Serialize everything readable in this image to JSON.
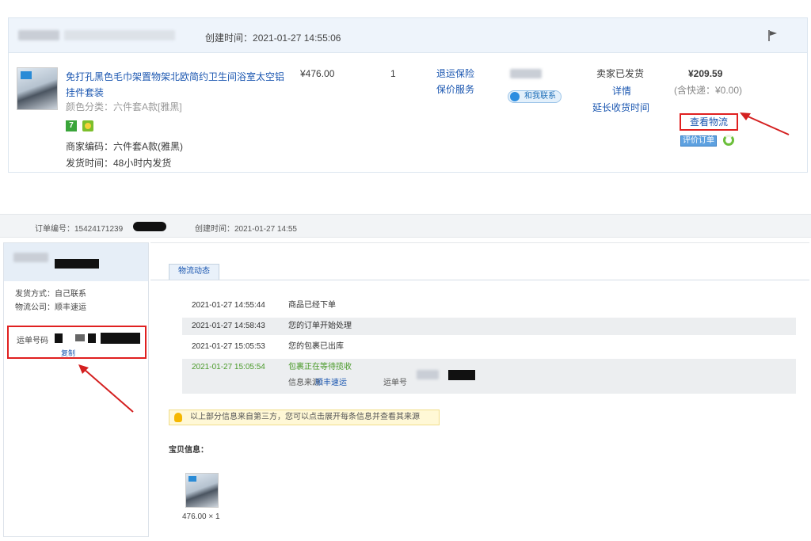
{
  "colors": {
    "header_bg": "#eef4fb",
    "link": "#1a56b0",
    "highlight_red": "#e02020",
    "success_green": "#4a9a2a",
    "notice_bg": "#fff8d6"
  },
  "order_card": {
    "created_label": "创建时间：",
    "created_value": "2021-01-27 14:55:06",
    "product": {
      "title": "免打孔黑色毛巾架置物架北欧简约卫生间浴室太空铝挂件套装",
      "sku": "颜色分类：六件套A款[雅黑]",
      "merchant_code": "商家编码：六件套A款(雅黑)",
      "ship_time": "发货时间：48小时内发货",
      "badge_7": "7"
    },
    "unit_price": "¥476.00",
    "quantity": "1",
    "service_1": "退运保险",
    "service_2": "保价服务",
    "contact_button": "和我联系",
    "status": "卖家已发货",
    "detail_link": "详情",
    "extend_link": "延长收货时间",
    "total_price": "¥209.59",
    "shipping_included": "(含快递：¥0.00)",
    "view_logistics_button": "查看物流",
    "evaluate_button": "评价订单",
    "icons": [
      "flag-icon",
      "refresh-icon"
    ]
  },
  "order_bar": {
    "order_no_label": "订单编号：15424171239",
    "created_label": "创建时间：",
    "created_value": "2021-01-27 14:55"
  },
  "left_panel": {
    "ship_method": "发货方式：自己联系",
    "logistics_company": "物流公司：顺丰速运",
    "tracking_label": "运单号码",
    "copy_link": "复制"
  },
  "right_panel": {
    "tab_label": "物流动态",
    "timeline": [
      {
        "time": "2021-01-27 14:55:44",
        "message": "商品已经下单"
      },
      {
        "time": "2021-01-27 14:58:43",
        "message": "您的订单开始处理"
      },
      {
        "time": "2021-01-27 15:05:53",
        "message": "您的包裹已出库"
      },
      {
        "time": "2021-01-27 15:05:54",
        "message": "包裹正在等待揽收"
      }
    ],
    "source_label": "信息来源：",
    "source_link": "顺丰速运",
    "tracking_label": "运单号",
    "notice": "以上部分信息来自第三方，您可以点击展开每条信息并查看其来源",
    "package_title": "宝贝信息：",
    "package_price": "476.00 × 1"
  }
}
